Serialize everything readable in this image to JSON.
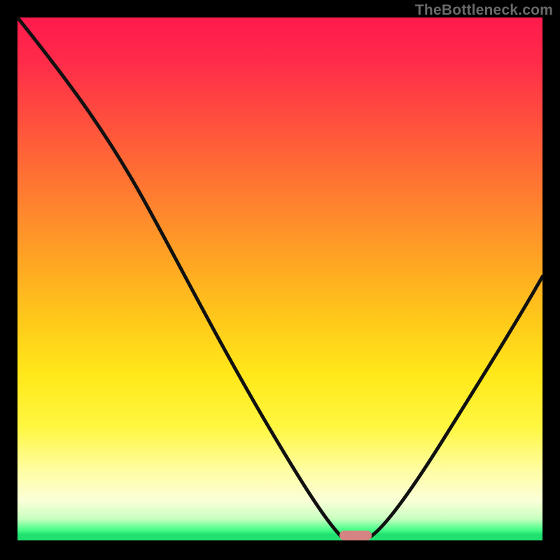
{
  "watermark": "TheBottleneck.com",
  "colors": {
    "page_bg": "#000000",
    "gradient_top": "#ff1a4d",
    "gradient_mid": "#ffca1a",
    "gradient_bottom_pale": "#fbffd8",
    "gradient_green": "#20e070",
    "curve_stroke": "#111111",
    "marker_fill": "#d58383",
    "watermark_color": "#6a6a6a"
  },
  "chart_data": {
    "type": "line",
    "title": "",
    "xlabel": "",
    "ylabel": "",
    "xlim": [
      0,
      100
    ],
    "ylim": [
      0,
      100
    ],
    "grid": false,
    "legend": false,
    "x": [
      0,
      5,
      10,
      15,
      20,
      25,
      30,
      35,
      40,
      45,
      50,
      55,
      60,
      62,
      64,
      66,
      70,
      75,
      80,
      85,
      90,
      95,
      100
    ],
    "values": [
      100,
      93,
      86,
      79,
      72,
      65,
      57,
      49,
      41,
      33,
      25,
      16,
      7,
      2,
      0,
      0,
      4,
      12,
      21,
      30,
      40,
      49,
      58
    ],
    "marker": {
      "x": 65,
      "y": 0
    }
  }
}
